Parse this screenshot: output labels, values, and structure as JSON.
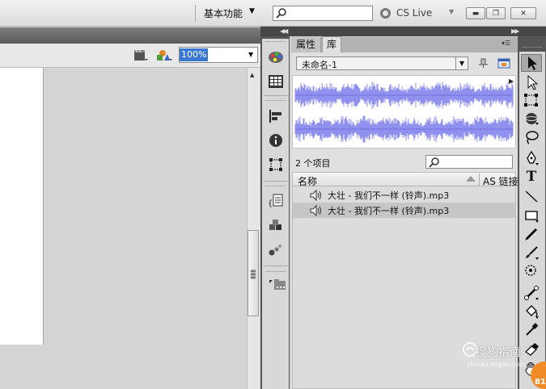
{
  "header": {
    "workspace_label": "基本功能",
    "search_placeholder": "",
    "cslive_label": "CS Live"
  },
  "stage": {
    "zoom_value": "100%"
  },
  "library_panel": {
    "tabs": [
      {
        "label": "属性"
      },
      {
        "label": "库"
      }
    ],
    "document_select": "未命名-1",
    "items_count": "2 个项目",
    "columns": {
      "name": "名称",
      "linkage": "AS 链接"
    },
    "items": [
      {
        "label": "大壮 - 我们不一样 (铃声).mp3",
        "selected": false
      },
      {
        "label": "大壮 - 我们不一样 (铃声).mp3",
        "selected": true
      }
    ]
  },
  "waveform_color": "#9090ee",
  "selection_color": "#3877d2",
  "watermark": {
    "text": "搜狗指南",
    "url": "zhinan.sogou.com",
    "badge": "81"
  }
}
